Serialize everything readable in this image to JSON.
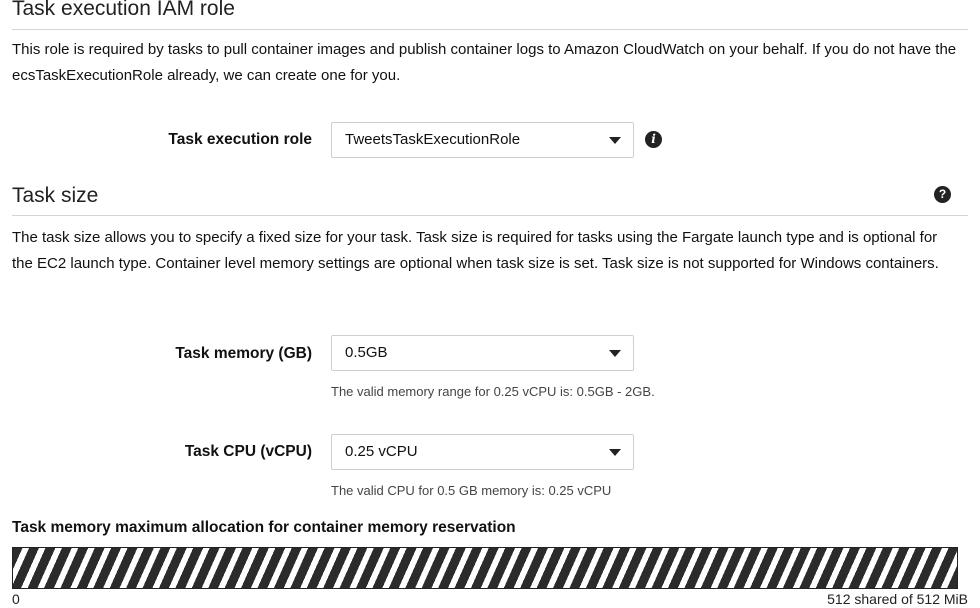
{
  "iam_section": {
    "title": "Task execution IAM role",
    "description": "This role is required by tasks to pull container images and publish container logs to Amazon CloudWatch on your behalf. If you do not have the ecsTaskExecutionRole already, we can create one for you.",
    "role_label": "Task execution role",
    "role_value": "TweetsTaskExecutionRole",
    "info_icon": "info-icon"
  },
  "size_section": {
    "title": "Task size",
    "help_icon": "question-circle-icon",
    "description": "The task size allows you to specify a fixed size for your task. Task size is required for tasks using the Fargate launch type and is optional for the EC2 launch type. Container level memory settings are optional when task size is set. Task size is not supported for Windows containers.",
    "memory_label": "Task memory (GB)",
    "memory_value": "0.5GB",
    "memory_help": "The valid memory range for 0.25 vCPU is: 0.5GB - 2GB.",
    "cpu_label": "Task CPU (vCPU)",
    "cpu_value": "0.25 vCPU",
    "cpu_help": "The valid CPU for 0.5 GB memory is: 0.25 vCPU"
  },
  "allocation": {
    "title": "Task memory maximum allocation for container memory reservation",
    "min_label": "0",
    "max_label": "512 shared of 512 MiB",
    "allocated_fraction": 1.0
  }
}
